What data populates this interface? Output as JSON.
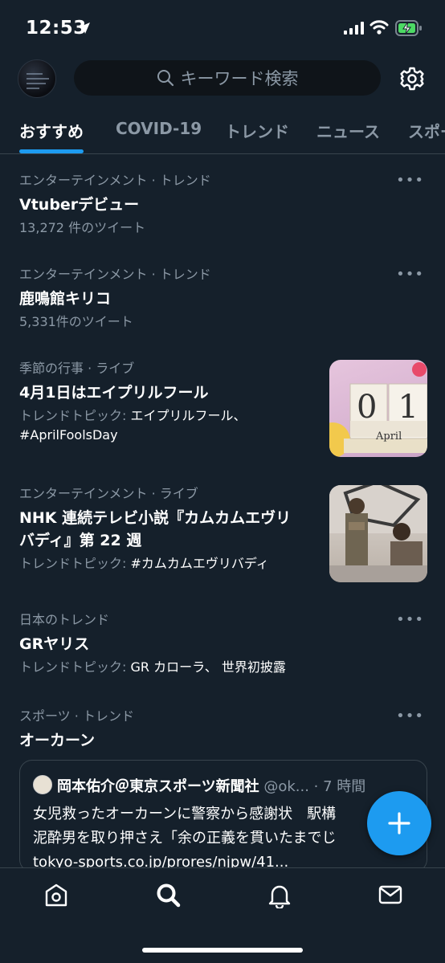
{
  "status": {
    "time": "12:53"
  },
  "search": {
    "placeholder": "キーワード検索"
  },
  "tabs": [
    {
      "label": "おすすめ"
    },
    {
      "label": "COVID-19"
    },
    {
      "label": "トレンド"
    },
    {
      "label": "ニュース"
    },
    {
      "label": "スポー"
    }
  ],
  "trends": [
    {
      "meta": "エンターテインメント · トレンド",
      "title": "Vtuberデビュー",
      "sub": "13,272 件のツイート"
    },
    {
      "meta": "エンターテインメント · トレンド",
      "title": "鹿鳴館キリコ",
      "sub": "5,331件のツイート"
    },
    {
      "meta_category": "季節の行事",
      "meta_suffix": " · ライブ",
      "title": "4月1日はエイプリルフール",
      "sub_prefix": "トレンドトピック: ",
      "sub_topics": "エイプリルフール、",
      "sub_line2": "#AprilFoolsDay",
      "thumb": {
        "top_text": "01",
        "bottom_text": "April"
      }
    },
    {
      "meta_category": "エンターテインメント",
      "meta_suffix": " · ライブ",
      "title_line1": "NHK 連続テレビ小説『カムカムエヴリ",
      "title_line2": "バディ』第 22 週",
      "sub_prefix": "トレンドトピック: ",
      "sub_topics": "#カムカムエヴリバディ"
    },
    {
      "meta": "日本のトレンド",
      "title": "GRヤリス",
      "sub_prefix": "トレンドトピック: ",
      "sub_topics": "GR カローラ、 世界初披露"
    },
    {
      "meta": "スポーツ · トレンド",
      "title": "オーカーン"
    }
  ],
  "card": {
    "author": "岡本佑介＠東京スポーツ新聞社",
    "handle": " @ok... · 7 時間",
    "line1": "女児救ったオーカーンに警察から感謝状　駅構",
    "line2": "泥酔男を取り押さえ「余の正義を貫いたまでじ",
    "line3": "tokyo-sports.co.jp/prores/njpw/41..."
  },
  "more_label": "•••",
  "colors": {
    "accent": "#1d9bf0",
    "background": "#15202b",
    "secondary_text": "#8b98a5"
  }
}
